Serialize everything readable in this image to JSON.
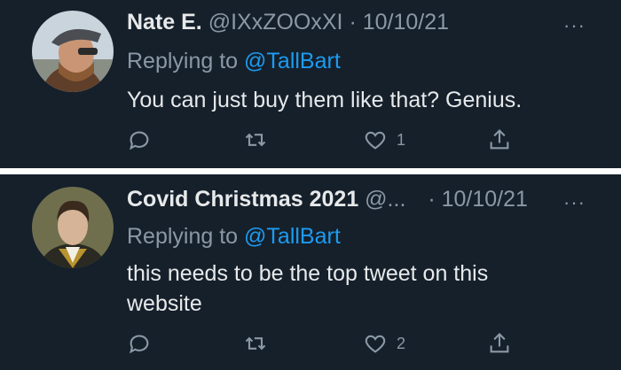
{
  "tweets": [
    {
      "name": "Nate E.",
      "handle": "@IXxZOOxXI",
      "separator": "·",
      "date": "10/10/21",
      "replying_prefix": "Replying to ",
      "replying_to": "@TallBart",
      "text": "You can just buy them like that? Genius.",
      "like_count": "1",
      "more": "···",
      "icons": [
        "reply-icon",
        "retweet-icon",
        "like-icon",
        "share-icon"
      ]
    },
    {
      "name": "Covid Christmas 2021",
      "handle": "@...",
      "separator": "·",
      "date": "10/10/21",
      "replying_prefix": "Replying to ",
      "replying_to": "@TallBart",
      "text": "this needs to be the top tweet on this website",
      "like_count": "2",
      "more": "···",
      "icons": [
        "reply-icon",
        "retweet-icon",
        "like-icon",
        "share-icon"
      ]
    }
  ],
  "colors": {
    "background": "#15202b",
    "divider": "#ffffff",
    "text_primary": "#e7e9ea",
    "text_secondary": "#8b98a5",
    "link": "#1d9bf0"
  }
}
